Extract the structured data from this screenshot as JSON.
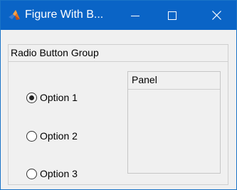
{
  "window": {
    "title": "Figure With B...",
    "titlebar_color": "#0a64c6",
    "app_icon": "matlab-icon",
    "controls": {
      "minimize_icon": "minimize-icon",
      "maximize_icon": "maximize-icon",
      "close_icon": "close-icon"
    }
  },
  "button_group": {
    "title": "Radio Button Group",
    "options": [
      {
        "label": "Option 1",
        "selected": true
      },
      {
        "label": "Option 2",
        "selected": false
      },
      {
        "label": "Option 3",
        "selected": false
      }
    ]
  },
  "panel": {
    "title": "Panel"
  }
}
